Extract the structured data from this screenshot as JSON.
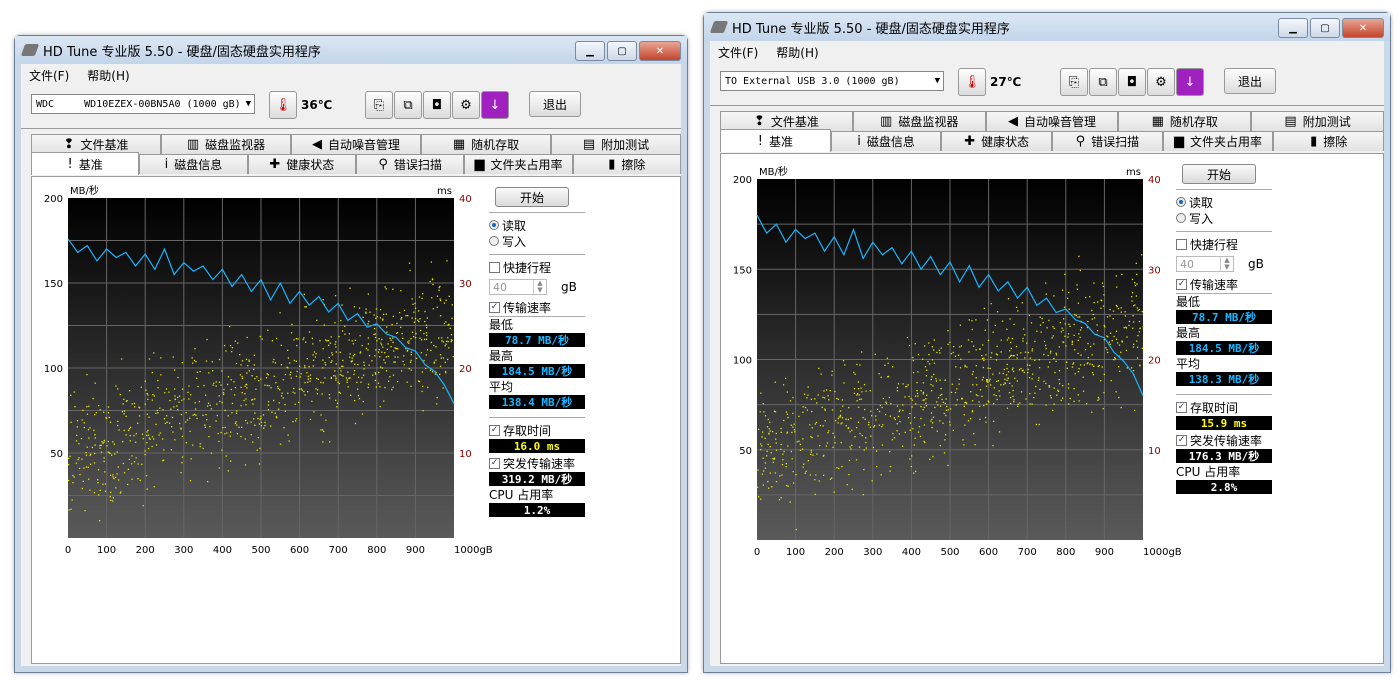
{
  "windows": [
    {
      "title": "HD Tune 专业版 5.50 - 硬盘/固态硬盘实用程序",
      "menu": [
        "文件(F)",
        "帮助(H)"
      ],
      "drive": "WDC     WD10EZEX-00BN5A0 (1000 gB)",
      "temperature": "36℃",
      "exit_label": "退出",
      "tabs_top": [
        {
          "label": "文件基准",
          "icon": "file-benchmark-icon",
          "glyph": "❢"
        },
        {
          "label": "磁盘监视器",
          "icon": "disk-monitor-icon",
          "glyph": "▥"
        },
        {
          "label": "自动噪音管理",
          "icon": "speaker-icon",
          "glyph": "◀"
        },
        {
          "label": "随机存取",
          "icon": "random-access-icon",
          "glyph": "▦"
        },
        {
          "label": "附加测试",
          "icon": "extra-tests-icon",
          "glyph": "▤"
        }
      ],
      "tabs_bottom": [
        {
          "label": "基准",
          "icon": "exclamation-icon",
          "glyph": "!",
          "active": true
        },
        {
          "label": "磁盘信息",
          "icon": "info-icon",
          "glyph": "i"
        },
        {
          "label": "健康状态",
          "icon": "health-cross-icon",
          "glyph": "✚"
        },
        {
          "label": "错误扫描",
          "icon": "magnifier-icon",
          "glyph": "⚲"
        },
        {
          "label": "文件夹占用率",
          "icon": "folder-icon",
          "glyph": "▆"
        },
        {
          "label": "擦除",
          "icon": "trash-icon",
          "glyph": "▮"
        }
      ],
      "panel": {
        "start_label": "开始",
        "read_label": "读取",
        "write_label": "写入",
        "mode": "read",
        "short_stroke_label": "快捷行程",
        "short_stroke_checked": false,
        "short_stroke_value": "40",
        "short_stroke_unit": "gB",
        "transfer_rate_label": "传输速率",
        "transfer_rate_checked": true,
        "min_label": "最低",
        "min_value": "78.7 MB/秒",
        "max_label": "最高",
        "max_value": "184.5 MB/秒",
        "avg_label": "平均",
        "avg_value": "138.4 MB/秒",
        "access_time_label": "存取时间",
        "access_time_checked": true,
        "access_time_value": "16.0 ms",
        "burst_label": "突发传输速率",
        "burst_checked": true,
        "burst_value": "319.2 MB/秒",
        "cpu_label": "CPU 占用率",
        "cpu_value": "1.2%"
      },
      "chart_data": {
        "type": "line",
        "ylabel": "MB/秒",
        "y2label": "ms",
        "xlim": [
          0,
          1000
        ],
        "ylim": [
          0,
          200
        ],
        "y2lim": [
          0,
          40
        ],
        "x_ticks": [
          "0",
          "100",
          "200",
          "300",
          "400",
          "500",
          "600",
          "700",
          "800",
          "900",
          "1000gB"
        ],
        "y_ticks": [
          "50",
          "100",
          "150",
          "200"
        ],
        "y2_ticks": [
          "10",
          "20",
          "30",
          "40"
        ],
        "grid": true,
        "series": [
          {
            "kind": "transfer_rate",
            "color": "#19b4ff",
            "unit": "MB/s",
            "x": [
              0,
              25,
              50,
              75,
              100,
              125,
              150,
              175,
              200,
              225,
              250,
              275,
              300,
              325,
              350,
              375,
              400,
              425,
              450,
              475,
              500,
              525,
              550,
              575,
              600,
              625,
              650,
              675,
              700,
              725,
              750,
              775,
              800,
              825,
              850,
              875,
              900,
              925,
              950,
              975,
              1000
            ],
            "y": [
              176,
              168,
              172,
              163,
              170,
              165,
              168,
              160,
              167,
              158,
              170,
              155,
              162,
              157,
              160,
              152,
              158,
              148,
              155,
              145,
              152,
              140,
              150,
              138,
              145,
              137,
              142,
              133,
              138,
              128,
              132,
              124,
              126,
              120,
              118,
              112,
              110,
              102,
              98,
              90,
              79
            ]
          },
          {
            "kind": "access_time",
            "color": "#e6e600",
            "unit": "ms",
            "trend_x": [
              0,
              1000
            ],
            "trend_y": [
              10,
              25
            ]
          }
        ]
      }
    },
    {
      "title": "HD Tune 专业版 5.50 - 硬盘/固态硬盘实用程序",
      "menu": [
        "文件(F)",
        "帮助(H)"
      ],
      "drive": "TO External USB 3.0 (1000 gB)",
      "temperature": "27℃",
      "exit_label": "退出",
      "tabs_top": [
        {
          "label": "文件基准",
          "icon": "file-benchmark-icon",
          "glyph": "❢"
        },
        {
          "label": "磁盘监视器",
          "icon": "disk-monitor-icon",
          "glyph": "▥"
        },
        {
          "label": "自动噪音管理",
          "icon": "speaker-icon",
          "glyph": "◀"
        },
        {
          "label": "随机存取",
          "icon": "random-access-icon",
          "glyph": "▦"
        },
        {
          "label": "附加测试",
          "icon": "extra-tests-icon",
          "glyph": "▤"
        }
      ],
      "tabs_bottom": [
        {
          "label": "基准",
          "icon": "exclamation-icon",
          "glyph": "!",
          "active": true
        },
        {
          "label": "磁盘信息",
          "icon": "info-icon",
          "glyph": "i"
        },
        {
          "label": "健康状态",
          "icon": "health-cross-icon",
          "glyph": "✚"
        },
        {
          "label": "错误扫描",
          "icon": "magnifier-icon",
          "glyph": "⚲"
        },
        {
          "label": "文件夹占用率",
          "icon": "folder-icon",
          "glyph": "▆"
        },
        {
          "label": "擦除",
          "icon": "trash-icon",
          "glyph": "▮"
        }
      ],
      "panel": {
        "start_label": "开始",
        "read_label": "读取",
        "write_label": "写入",
        "mode": "read",
        "short_stroke_label": "快捷行程",
        "short_stroke_checked": false,
        "short_stroke_value": "40",
        "short_stroke_unit": "gB",
        "transfer_rate_label": "传输速率",
        "transfer_rate_checked": true,
        "min_label": "最低",
        "min_value": "78.7 MB/秒",
        "max_label": "最高",
        "max_value": "184.5 MB/秒",
        "avg_label": "平均",
        "avg_value": "138.3 MB/秒",
        "access_time_label": "存取时间",
        "access_time_checked": true,
        "access_time_value": "15.9 ms",
        "burst_label": "突发传输速率",
        "burst_checked": true,
        "burst_value": "176.3 MB/秒",
        "cpu_label": "CPU 占用率",
        "cpu_value": "2.8%"
      },
      "chart_data": {
        "type": "line",
        "ylabel": "MB/秒",
        "y2label": "ms",
        "xlim": [
          0,
          1000
        ],
        "ylim": [
          0,
          200
        ],
        "y2lim": [
          0,
          40
        ],
        "x_ticks": [
          "0",
          "100",
          "200",
          "300",
          "400",
          "500",
          "600",
          "700",
          "800",
          "900",
          "1000gB"
        ],
        "y_ticks": [
          "50",
          "100",
          "150",
          "200"
        ],
        "y2_ticks": [
          "10",
          "20",
          "30",
          "40"
        ],
        "grid": true,
        "series": [
          {
            "kind": "transfer_rate",
            "color": "#19b4ff",
            "unit": "MB/s",
            "x": [
              0,
              25,
              50,
              75,
              100,
              125,
              150,
              175,
              200,
              225,
              250,
              275,
              300,
              325,
              350,
              375,
              400,
              425,
              450,
              475,
              500,
              525,
              550,
              575,
              600,
              625,
              650,
              675,
              700,
              725,
              750,
              775,
              800,
              825,
              850,
              875,
              900,
              925,
              950,
              975,
              1000
            ],
            "y": [
              180,
              170,
              175,
              165,
              172,
              167,
              170,
              160,
              168,
              158,
              172,
              156,
              165,
              158,
              162,
              153,
              160,
              150,
              157,
              147,
              154,
              143,
              152,
              140,
              147,
              138,
              143,
              134,
              140,
              130,
              134,
              126,
              128,
              122,
              120,
              114,
              112,
              104,
              99,
              92,
              80
            ]
          },
          {
            "kind": "access_time",
            "color": "#e6e600",
            "unit": "ms",
            "trend_x": [
              0,
              1000
            ],
            "trend_y": [
              10,
              24
            ]
          }
        ]
      }
    }
  ]
}
